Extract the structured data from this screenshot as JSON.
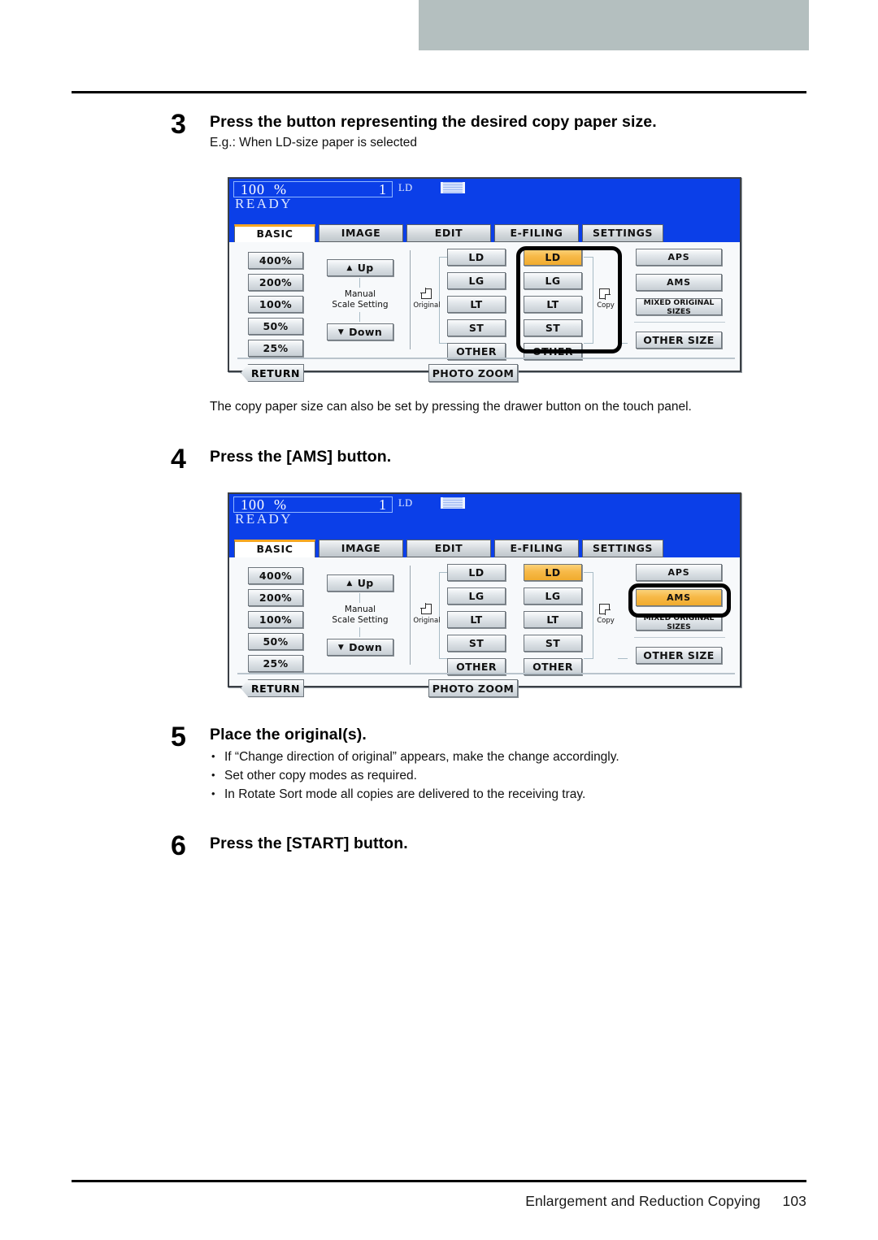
{
  "document": {
    "footer_title": "Enlargement and Reduction Copying",
    "page_number": "103"
  },
  "steps": [
    {
      "number": "3",
      "title": "Press the button representing the desired copy paper size.",
      "subtitle": "E.g.: When LD-size paper is selected"
    },
    {
      "number": "4",
      "title": "Press the [AMS] button."
    },
    {
      "number": "5",
      "title": "Place the original(s).",
      "bullets": [
        "If “Change direction of original” appears, make the change accordingly.",
        "Set other copy modes as required.",
        "In Rotate Sort mode all copies are delivered to the receiving tray."
      ]
    },
    {
      "number": "6",
      "title": "Press the [START] button."
    }
  ],
  "notes": {
    "drawer_note": "The copy paper size can also be set by pressing the drawer button on the touch panel."
  },
  "panel": {
    "status": {
      "zoom": "100",
      "percent": "%",
      "copy_count": "1",
      "ready": "READY",
      "paper_size": "LD",
      "tray_icon": "paper-tray-icon"
    },
    "tabs": [
      {
        "label": "BASIC",
        "active": true
      },
      {
        "label": "IMAGE",
        "active": false
      },
      {
        "label": "EDIT",
        "active": false
      },
      {
        "label": "E-FILING",
        "active": false
      },
      {
        "label": "SETTINGS",
        "active": false
      }
    ],
    "ratio_buttons": [
      "400%",
      "200%",
      "100%",
      "50%",
      "25%"
    ],
    "manual": {
      "up_label": "Up",
      "down_label": "Down",
      "caption_line1": "Manual",
      "caption_line2": "Scale Setting",
      "up_icon": "triangle-up-icon",
      "down_icon": "triangle-down-icon"
    },
    "original_column": {
      "caption": "Original",
      "icon": "original-page-icon",
      "sizes": [
        "LD",
        "LG",
        "LT",
        "ST",
        "OTHER"
      ]
    },
    "copy_column": {
      "caption": "Copy",
      "icon": "copy-page-icon",
      "sizes": [
        "LD",
        "LG",
        "LT",
        "ST",
        "OTHER"
      ]
    },
    "right_buttons": [
      "APS",
      "AMS",
      "MIXED ORIGINAL SIZES",
      "OTHER SIZE"
    ],
    "bottom_buttons": {
      "return_label": "RETURN",
      "photo_zoom_label": "PHOTO ZOOM"
    }
  },
  "screens": {
    "first": {
      "selected_copy_size": "LD",
      "selected_right_button": null,
      "highlight": "copy-size-column"
    },
    "second": {
      "selected_copy_size": "LD",
      "selected_right_button": "AMS",
      "highlight": "ams-button"
    }
  },
  "colors": {
    "lcd_header_blue": "#0b3fe8",
    "selected_orange": "#f7b948",
    "tab_active_accent": "#f6a623",
    "top_bar_gray": "#b4bfbf",
    "panel_bg": "#f7f9fb"
  }
}
